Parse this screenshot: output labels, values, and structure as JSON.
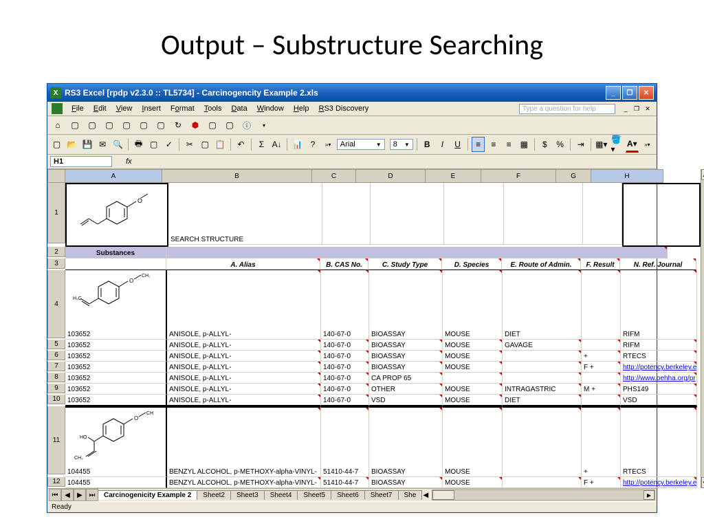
{
  "slide_title": "Output – Substructure Searching",
  "titlebar": "RS3 Excel [rpdp v2.3.0 :: TL5734] - Carcinogencity Example 2.xls",
  "menus": [
    "File",
    "Edit",
    "View",
    "Insert",
    "Format",
    "Tools",
    "Data",
    "Window",
    "Help",
    "RS3 Discovery"
  ],
  "help_placeholder": "Type a question for help",
  "font_name": "Arial",
  "font_size": "8",
  "namebox": "H1",
  "col_headers": [
    "A",
    "B",
    "C",
    "D",
    "E",
    "F",
    "G",
    "H"
  ],
  "row1_b": "SEARCH STRUCTURE",
  "row2_a": "Substances",
  "headers3": {
    "b": "A. Alias",
    "c": "B. CAS No.",
    "d": "C. Study Type",
    "e": "D. Species",
    "f": "E. Route of Admin.",
    "g": "F. Result",
    "h": "N. Ref. Journal"
  },
  "rows": [
    {
      "n": "4",
      "a": "103652",
      "b": "ANISOLE, p-ALLYL-",
      "c": "140-67-0",
      "d": "BIOASSAY",
      "e": "MOUSE",
      "f": "DIET",
      "g": "",
      "h": "RIFM"
    },
    {
      "n": "5",
      "a": "103652",
      "b": "ANISOLE, p-ALLYL-",
      "c": "140-67-0",
      "d": "BIOASSAY",
      "e": "MOUSE",
      "f": "GAVAGE",
      "g": "",
      "h": "RIFM"
    },
    {
      "n": "6",
      "a": "103652",
      "b": "ANISOLE, p-ALLYL-",
      "c": "140-67-0",
      "d": "BIOASSAY",
      "e": "MOUSE",
      "f": "",
      "g": "+",
      "h": "RTECS"
    },
    {
      "n": "7",
      "a": "103652",
      "b": "ANISOLE, p-ALLYL-",
      "c": "140-67-0",
      "d": "BIOASSAY",
      "e": "MOUSE",
      "f": "",
      "g": "F +",
      "h": "http://potency.berkeley.e",
      "link": true
    },
    {
      "n": "8",
      "a": "103652",
      "b": "ANISOLE, p-ALLYL-",
      "c": "140-67-0",
      "d": "CA PROP 65",
      "e": "",
      "f": "",
      "g": "",
      "h": "http://www.oehha.org/pr",
      "link": true
    },
    {
      "n": "9",
      "a": "103652",
      "b": "ANISOLE, p-ALLYL-",
      "c": "140-67-0",
      "d": "OTHER",
      "e": "MOUSE",
      "f": "INTRAGASTRIC",
      "g": "M +",
      "h": "PHS149"
    },
    {
      "n": "10",
      "a": "103652",
      "b": "ANISOLE, p-ALLYL-",
      "c": "140-67-0",
      "d": "VSD",
      "e": "MOUSE",
      "f": "DIET",
      "g": "",
      "h": "VSD"
    }
  ],
  "rows2": [
    {
      "n": "11",
      "a": "104455",
      "b": "BENZYL ALCOHOL, p-METHOXY-alpha-VINYL-",
      "c": "51410-44-7",
      "d": "BIOASSAY",
      "e": "MOUSE",
      "f": "",
      "g": "+",
      "h": "RTECS"
    },
    {
      "n": "12",
      "a": "104455",
      "b": "BENZYL ALCOHOL, p-METHOXY-alpha-VINYL-",
      "c": "51410-44-7",
      "d": "BIOASSAY",
      "e": "MOUSE",
      "f": "",
      "g": "F +",
      "h": "http://potency.berkeley.e",
      "link": true
    }
  ],
  "tabs": [
    "Carcinogenicity Example 2",
    "Sheet2",
    "Sheet3",
    "Sheet4",
    "Sheet5",
    "Sheet6",
    "Sheet7",
    "She"
  ],
  "status": "Ready"
}
